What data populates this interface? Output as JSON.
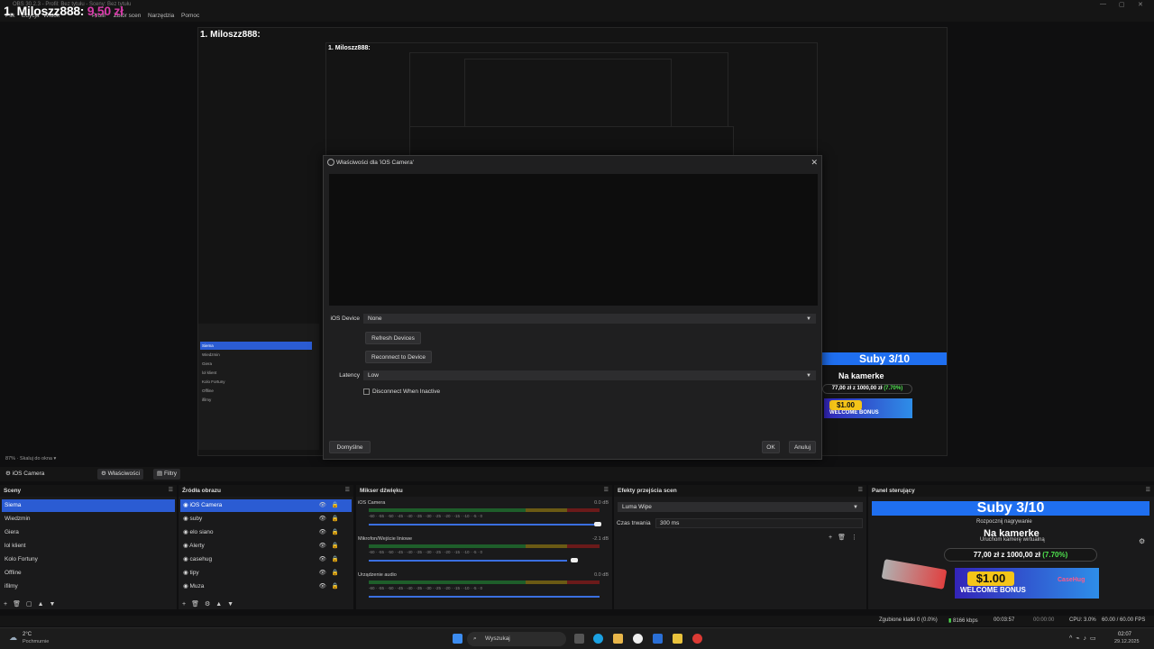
{
  "window": {
    "title": "OBS 30.2.3 - Profil: Bez tytułu - Sceny: Bez tytułu",
    "minimize": "—",
    "maximize": "▢",
    "close": "✕"
  },
  "menu": [
    "Plik",
    "Edycja",
    "Widok",
    "Profil",
    "Zbiór scen",
    "Narzędzia",
    "Pomoc"
  ],
  "overlay": {
    "donor": "1. Miloszz888:",
    "amount": "9,50 zł"
  },
  "right_overlay": {
    "subs": "Suby 3/10",
    "subs_sub": "Rozpocznij nagrywanie",
    "kamera": "Na kamerke",
    "kamera_sub": "Uruchom kamerę wirtualną",
    "goal": "77,00 zł z 1000,00 zł",
    "goal_pct": "(7.70%)",
    "coin": "$1.00",
    "bonus": "WELCOME BONUS",
    "brand": "CaseHug"
  },
  "dialog": {
    "title": "Właściwości dla 'iOS Camera'",
    "ios_device_label": "iOS Device",
    "ios_device_value": "None",
    "refresh": "Refresh Devices",
    "reconnect": "Reconnect to Device",
    "latency_label": "Latency",
    "latency_value": "Low",
    "disconnect": "Disconnect When Inactive",
    "defaults": "Domyślne",
    "ok": "OK",
    "cancel": "Anuluj"
  },
  "zoom": {
    "value": "87%",
    "mode": "Skaluj do okna"
  },
  "source_bar": {
    "name": "iOS Camera",
    "properties": "Właściwości",
    "filters": "Filtry"
  },
  "scenes": {
    "title": "Sceny",
    "items": [
      "Siema",
      "Wiedzmin",
      "Giera",
      "lol klient",
      "Kolo Fortuny",
      "Offline",
      "ifilmy"
    ]
  },
  "sources": {
    "title": "Źródła obrazu",
    "items": [
      "iOS Camera",
      "suby",
      "elo siano",
      "Alerty",
      "casehug",
      "tipy",
      "Muza"
    ]
  },
  "mixer": {
    "title": "Mikser dźwięku",
    "channels": [
      {
        "name": "iOS Camera",
        "db": "0.0 dB",
        "level": 1.0
      },
      {
        "name": "Mikrofon/Wejście liniowe",
        "db": "-2.1 dB",
        "level": 0.85
      },
      {
        "name": "Urządzenie audio",
        "db": "0.0 dB",
        "level": 1.0
      }
    ],
    "scale": [
      "-60",
      "-55",
      "-50",
      "-45",
      "-40",
      "-35",
      "-30",
      "-25",
      "-20",
      "-15",
      "-10",
      "-5",
      "0"
    ]
  },
  "transitions": {
    "title": "Efekty przejścia scen",
    "value": "Luma Wipe",
    "duration_label": "Czas trwania",
    "duration_value": "300 ms"
  },
  "controls": {
    "title": "Panel sterujący"
  },
  "status": {
    "dropped": "Zgubione klatki 0 (0.0%)",
    "kbps": "8166 kbps",
    "live_time": "00:03:57",
    "rec_time": "00:00:00",
    "cpu": "CPU: 3.0%",
    "fps": "60.00 / 60.00 FPS"
  },
  "taskbar": {
    "weather_temp": "2°C",
    "weather_desc": "Pochmurnie",
    "search": "Wyszukaj",
    "time": "02:07",
    "date": "29.12.2025"
  },
  "colors": {
    "accent": "#2b5cd3",
    "pink": "#d63aa8",
    "green": "#4ee34e"
  }
}
